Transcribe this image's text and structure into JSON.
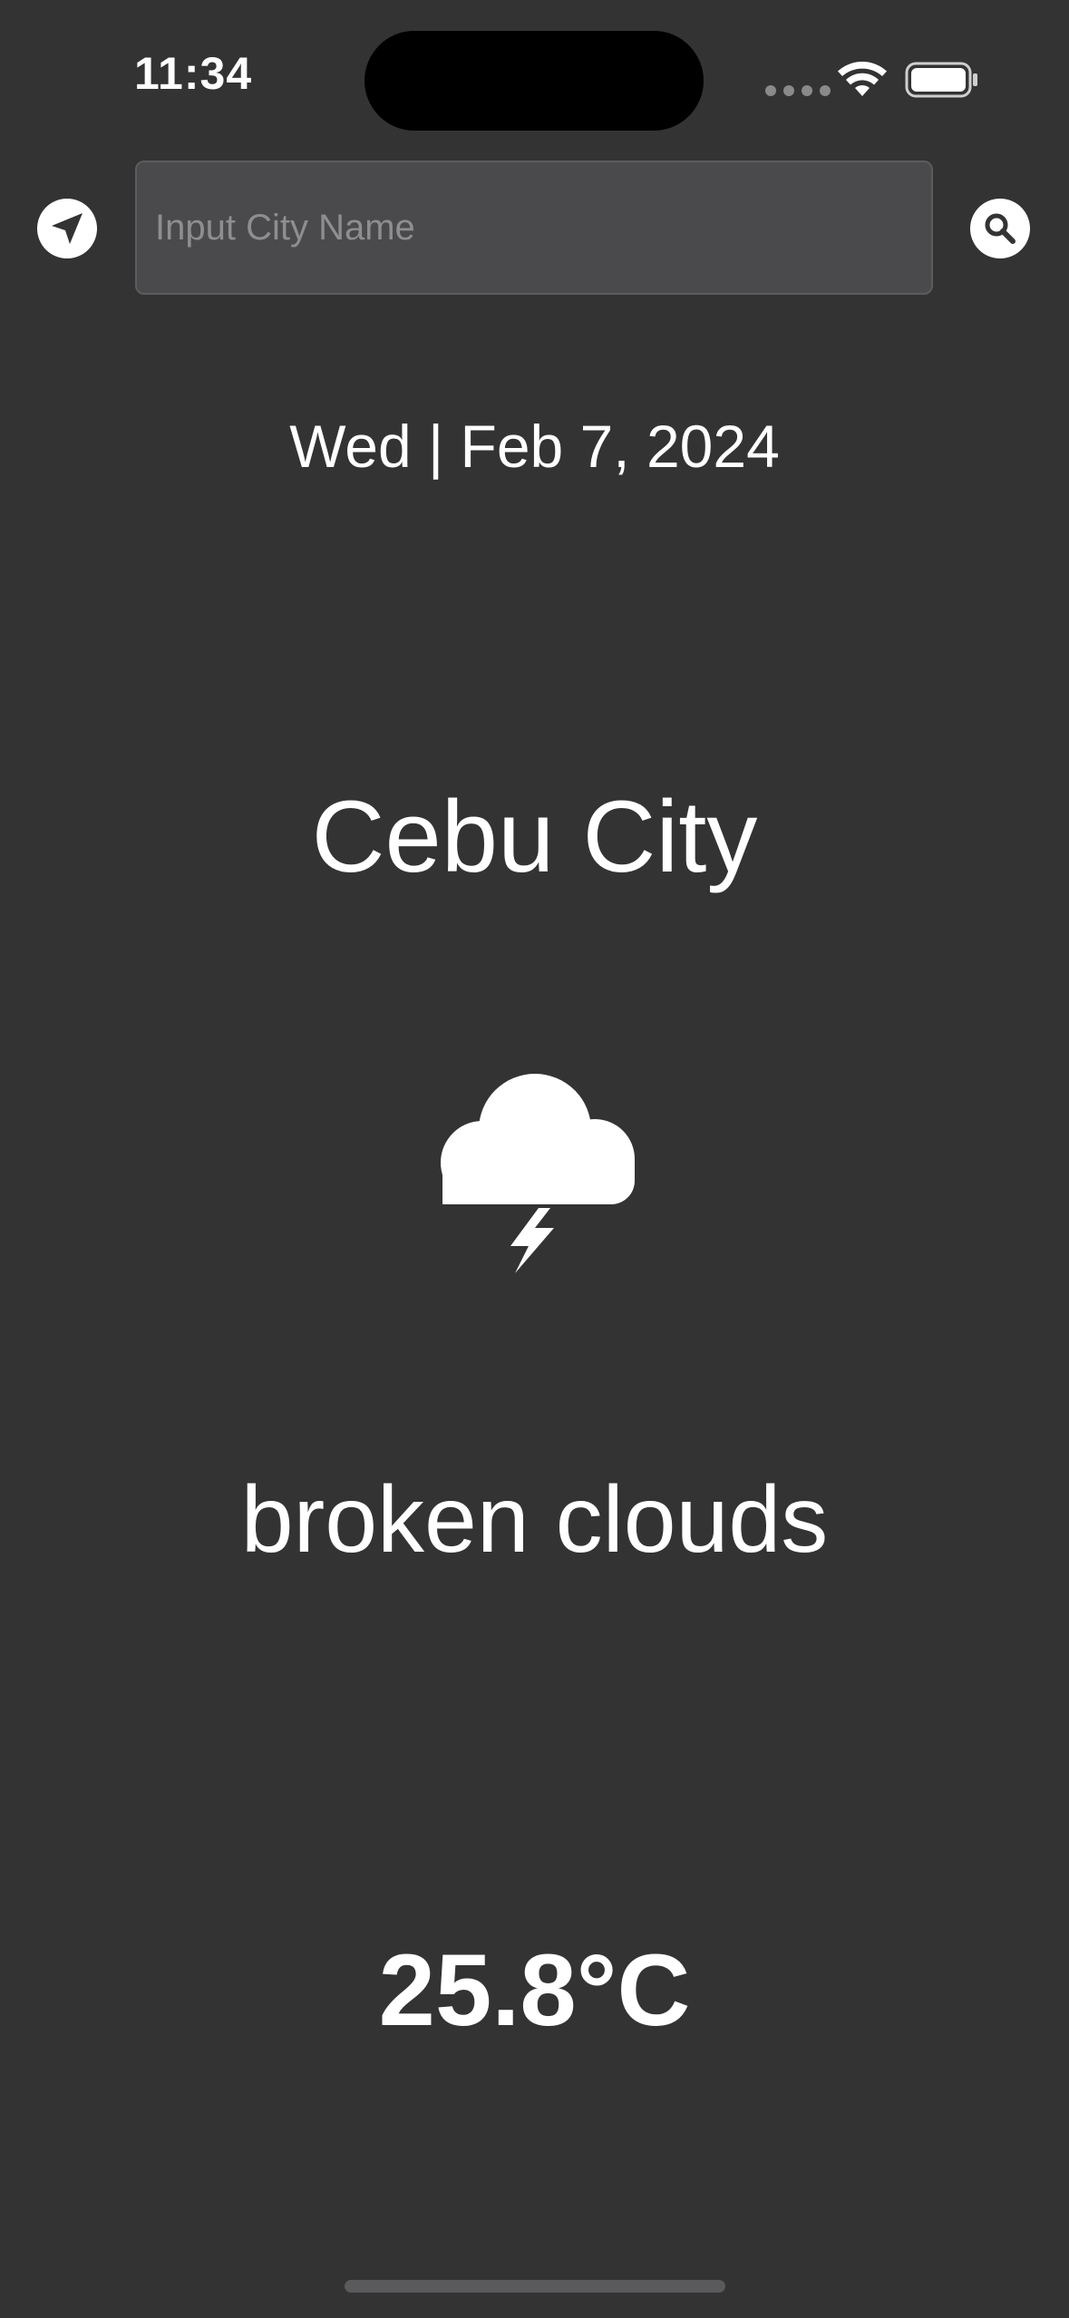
{
  "status_bar": {
    "time": "11:34"
  },
  "search": {
    "placeholder": "Input City Name",
    "value": ""
  },
  "icons": {
    "location": "location-arrow-icon",
    "search": "magnifying-glass-icon",
    "weather": "cloud-bolt-icon"
  },
  "weather": {
    "date": "Wed | Feb 7, 2024",
    "city": "Cebu City",
    "description": "broken clouds",
    "temperature": "25.8°C"
  },
  "colors": {
    "background": "#333333",
    "text": "#ffffff",
    "search_field_bg": "#4a4a4c",
    "placeholder": "#8e8e90"
  }
}
